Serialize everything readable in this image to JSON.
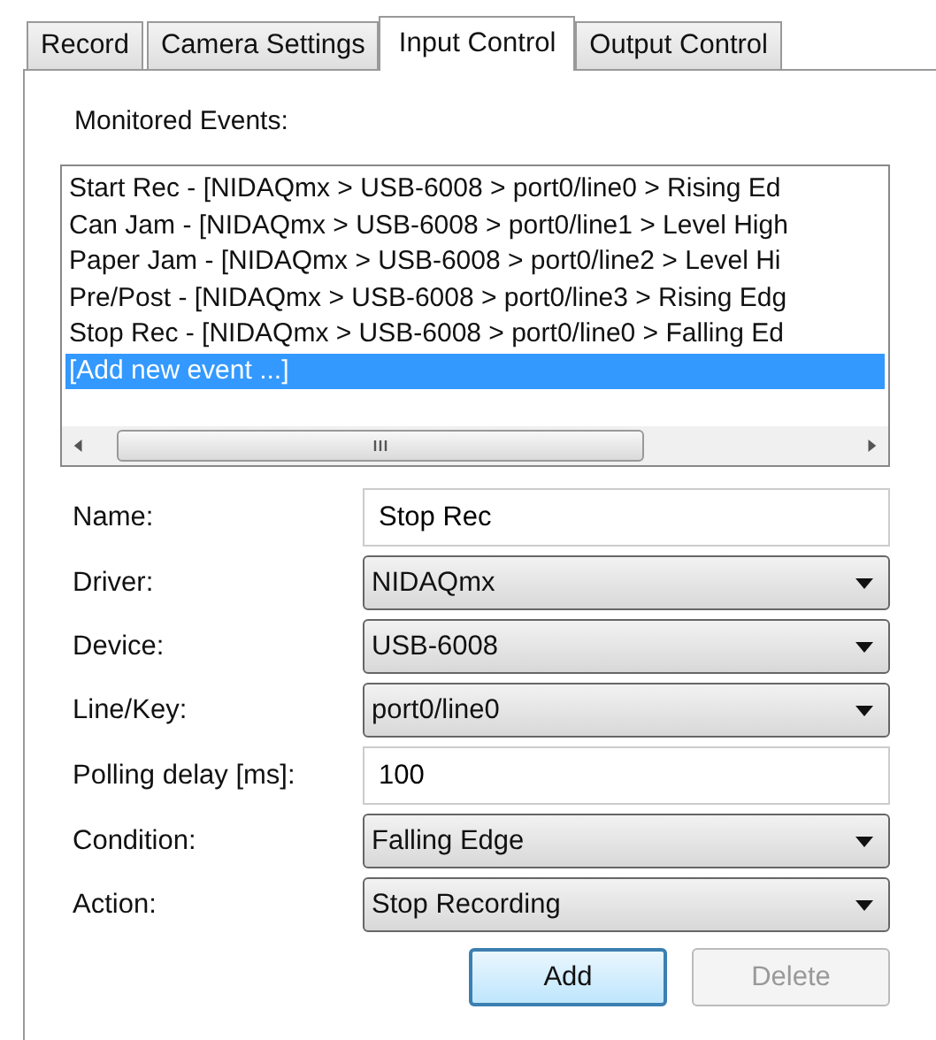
{
  "tabs": [
    {
      "label": "Record",
      "selected": false
    },
    {
      "label": "Camera Settings",
      "selected": false
    },
    {
      "label": "Input Control",
      "selected": true
    },
    {
      "label": "Output Control",
      "selected": false
    }
  ],
  "events": {
    "label": "Monitored Events:",
    "items": [
      {
        "text": "Start Rec - [NIDAQmx > USB-6008 > port0/line0 > Rising Ed",
        "selected": false
      },
      {
        "text": "Can Jam - [NIDAQmx > USB-6008 > port0/line1 > Level High",
        "selected": false
      },
      {
        "text": "Paper Jam - [NIDAQmx > USB-6008 > port0/line2 > Level Hi",
        "selected": false
      },
      {
        "text": "Pre/Post - [NIDAQmx > USB-6008 > port0/line3 > Rising Edg",
        "selected": false
      },
      {
        "text": "Stop Rec - [NIDAQmx > USB-6008 > port0/line0 > Falling Ed",
        "selected": false
      },
      {
        "text": "[Add new event ...]",
        "selected": true
      }
    ]
  },
  "form": [
    {
      "label": "Name:",
      "kind": "text",
      "value": "Stop Rec"
    },
    {
      "label": "Driver:",
      "kind": "select",
      "value": "NIDAQmx"
    },
    {
      "label": "Device:",
      "kind": "select",
      "value": "USB-6008"
    },
    {
      "label": "Line/Key:",
      "kind": "select",
      "value": "port0/line0"
    },
    {
      "label": "Polling delay [ms]:",
      "kind": "text",
      "value": "100"
    },
    {
      "label": "Condition:",
      "kind": "select",
      "value": "Falling Edge"
    },
    {
      "label": "Action:",
      "kind": "select",
      "value": "Stop Recording"
    }
  ],
  "buttons": [
    {
      "label": "Add",
      "disabled": false,
      "default": true
    },
    {
      "label": "Delete",
      "disabled": true,
      "default": false
    }
  ]
}
